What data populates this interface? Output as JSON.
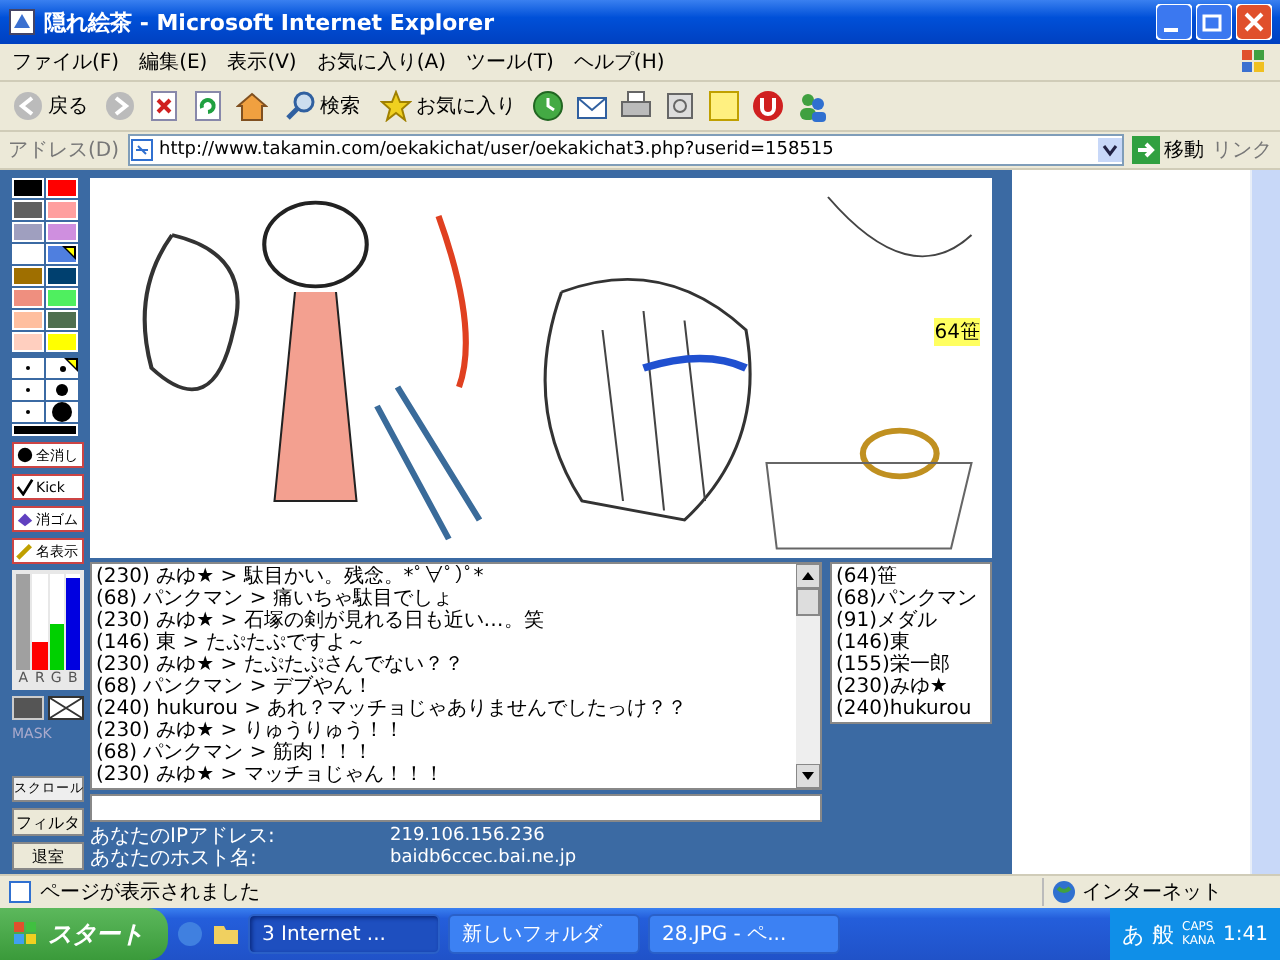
{
  "window": {
    "title": "隠れ絵茶 - Microsoft Internet Explorer"
  },
  "menu": [
    "ファイル(F)",
    "編集(E)",
    "表示(V)",
    "お気に入り(A)",
    "ツール(T)",
    "ヘルプ(H)"
  ],
  "toolbar": {
    "back": "戻る",
    "search": "検索",
    "favorites": "お気に入り"
  },
  "address": {
    "label": "アドレス(D)",
    "url": "http://www.takamin.com/oekakichat/user/oekakichat3.php?userid=158515",
    "go": "移動",
    "links": "リンク"
  },
  "palette": [
    {
      "color": "#000000",
      "selected": false
    },
    {
      "color": "#ff0000",
      "selected": false
    },
    {
      "color": "#606060",
      "selected": false
    },
    {
      "color": "#ff9f9f",
      "selected": false
    },
    {
      "color": "#9f9fbf",
      "selected": false
    },
    {
      "color": "#cf8fdf",
      "selected": false
    },
    {
      "color": "#ffffff",
      "selected": false
    },
    {
      "color": "#4f7fdf",
      "selected": true
    },
    {
      "color": "#9f6f00",
      "selected": false
    },
    {
      "color": "#00406f",
      "selected": false
    },
    {
      "color": "#ef8f7f",
      "selected": false
    },
    {
      "color": "#4fef5f",
      "selected": false
    },
    {
      "color": "#ffbf9f",
      "selected": false
    },
    {
      "color": "#4f6f4f",
      "selected": false
    },
    {
      "color": "#ffcfbf",
      "selected": false
    },
    {
      "color": "#ffff00",
      "selected": false
    }
  ],
  "pen_sizes": [
    {
      "kind": "xs",
      "selected": false
    },
    {
      "kind": "s",
      "selected": true
    },
    {
      "kind": "xs",
      "selected": false
    },
    {
      "kind": "m",
      "selected": false
    },
    {
      "kind": "xs",
      "selected": false
    },
    {
      "kind": "l",
      "selected": false
    }
  ],
  "tool_buttons": [
    {
      "kind": "clear",
      "label": "全消し"
    },
    {
      "kind": "kick",
      "label": "Kick"
    },
    {
      "kind": "eraser",
      "label": "消ゴム"
    },
    {
      "kind": "names",
      "label": "名表示"
    }
  ],
  "color_bars": [
    {
      "label": "A",
      "color": "#a0a0a0",
      "level": 1
    },
    {
      "label": "R",
      "color": "#ff0000",
      "level": 0.3
    },
    {
      "label": "G",
      "color": "#00d000",
      "level": 0.48
    },
    {
      "label": "B",
      "color": "#0000e0",
      "level": 0.95
    }
  ],
  "mask_label": "MASK",
  "scroll_button": "スクロール",
  "filter_button": "フィルタ",
  "leave_button": "退室",
  "canvas": {
    "name_tag": "64笹"
  },
  "chat": [
    "(230) みゆ★ > 駄目かい。残念。*ﾟ∀ﾟ)ﾟ*",
    "(68) パンクマン > 痛いちゃ駄目でしょ",
    "(230) みゆ★ > 石塚の剣が見れる日も近い…。笑",
    "(146) 東 > たぷたぷですよ～",
    "(230) みゆ★ > たぷたぷさんでない？？",
    "(68) パンクマン > デブやん！",
    "(240) hukurou > あれ？マッチョじゃありませんでしたっけ？？",
    "(230) みゆ★ > りゅうりゅう！！",
    "(68) パンクマン > 筋肉！！！",
    "(230) みゆ★ > マッチョじゃん！！！"
  ],
  "users": [
    "(64)笹",
    "(68)パンクマン",
    "(91)メダル",
    "(146)東",
    "(155)栄一郎",
    "(230)みゆ★",
    "(240)hukurou"
  ],
  "info": [
    {
      "label": "あなたのIPアドレス:",
      "value": "219.106.156.236"
    },
    {
      "label": "あなたのホスト名:",
      "value": "baidb6ccec.bai.ne.jp"
    }
  ],
  "status": {
    "text": "ページが表示されました",
    "zone": "インターネット"
  },
  "taskbar": {
    "start": "スタート",
    "tasks": [
      {
        "label": "3 Internet ...",
        "selected": true
      },
      {
        "label": "新しいフォルダ",
        "selected": false
      },
      {
        "label": "28.JPG - ペ...",
        "selected": false
      }
    ],
    "ime": [
      "あ",
      "般"
    ],
    "caps": "CAPS",
    "kana": "KANA",
    "clock": "1:41"
  }
}
